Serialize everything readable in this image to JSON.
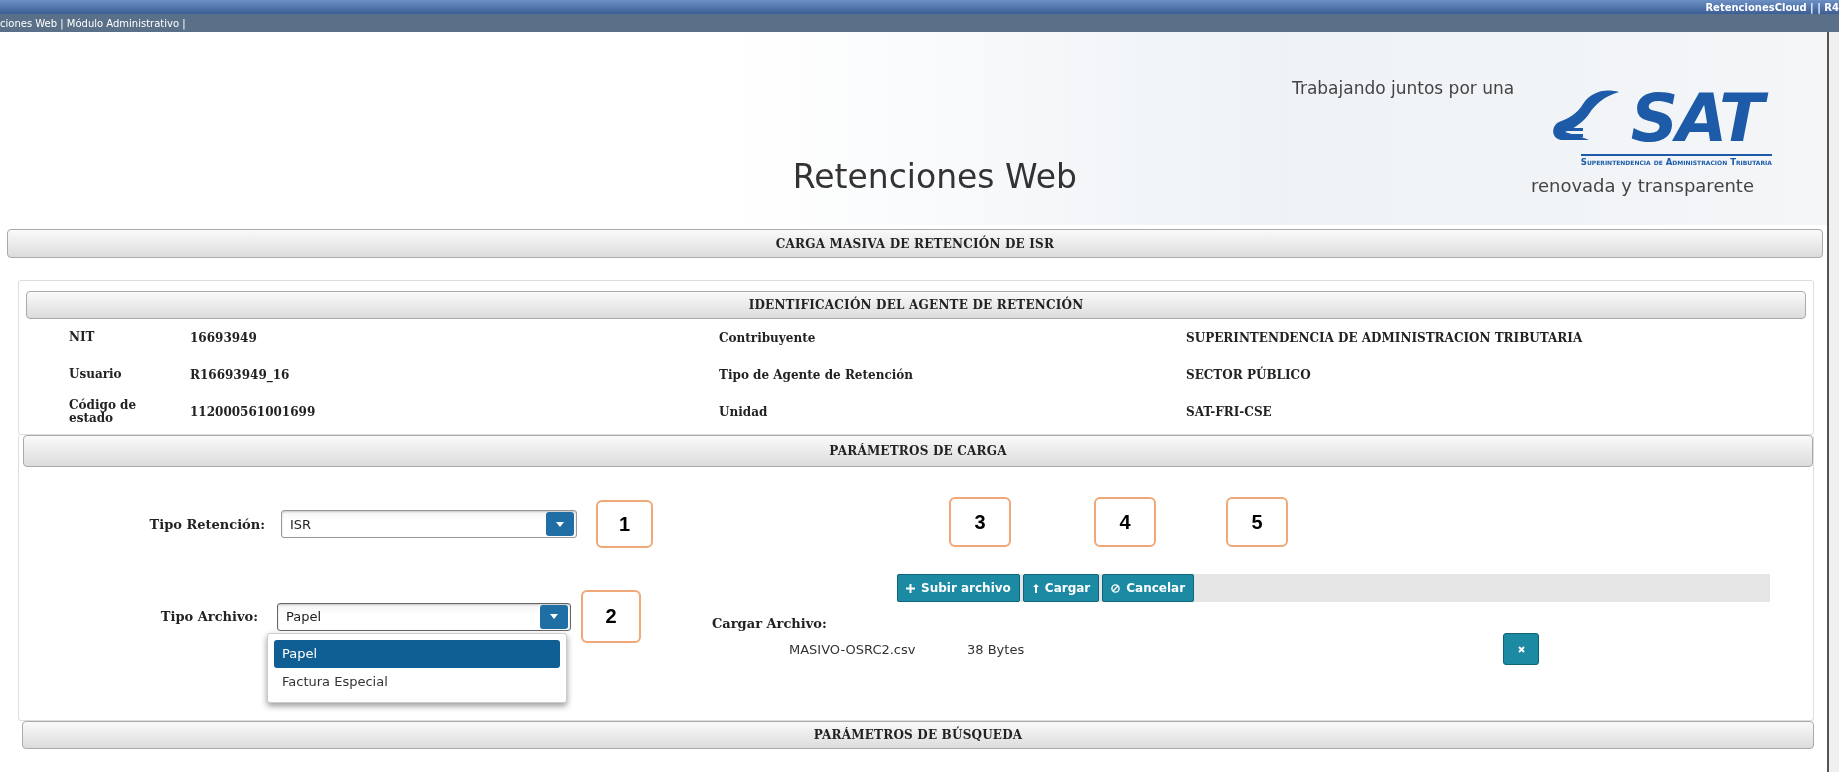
{
  "top_bar": {
    "text": "RetencionesCloud | | R4"
  },
  "breadcrumb": {
    "text": "ciones Web | Módulo Administrativo |"
  },
  "header": {
    "title": "Retenciones Web",
    "slogan_top": "Trabajando juntos por una",
    "logo_text": "SAT",
    "logo_subtitle": "Superintendencia de Administracion Tributaria",
    "slogan_bottom": "renovada y transparente"
  },
  "page_title": "CARGA MASIVA DE RETENCIÓN DE ISR",
  "identification": {
    "title": "IDENTIFICACIÓN DEL AGENTE DE RETENCIÓN",
    "rows": [
      {
        "label_1": "NIT",
        "value_1": "16693949",
        "label_2": "Contribuyente",
        "value_2": "SUPERINTENDENCIA DE ADMINISTRACION TRIBUTARIA"
      },
      {
        "label_1": "Usuario",
        "value_1": "R16693949_16",
        "label_2": "Tipo de Agente de Retención",
        "value_2": "SECTOR PÚBLICO"
      },
      {
        "label_1": "Código de estado",
        "value_1": "112000561001699",
        "label_2": "Unidad",
        "value_2": "SAT-FRI-CSE"
      }
    ]
  },
  "load_parameters": {
    "title": "PARÁMETROS DE CARGA",
    "tipo_retencion": {
      "label": "Tipo Retención:",
      "value": "ISR",
      "callout": "1"
    },
    "tipo_archivo": {
      "label": "Tipo Archivo:",
      "value": "Papel",
      "callout": "2",
      "expanded": true,
      "options": [
        {
          "label": "Papel",
          "selected": true
        },
        {
          "label": "Factura Especial",
          "selected": false
        }
      ]
    },
    "buttons": [
      {
        "label": "Subir archivo",
        "kind": "add",
        "callout": "3"
      },
      {
        "label": "Cargar",
        "kind": "upload",
        "callout": "4"
      },
      {
        "label": "Cancelar",
        "kind": "cancel",
        "callout": "5"
      }
    ],
    "file_label": "Cargar Archivo:",
    "file": {
      "name": "MASIVO-OSRC2.csv",
      "size": "38 Bytes"
    }
  },
  "search_parameters": {
    "title": "PARÁMETROS DE BÚSQUEDA"
  }
}
